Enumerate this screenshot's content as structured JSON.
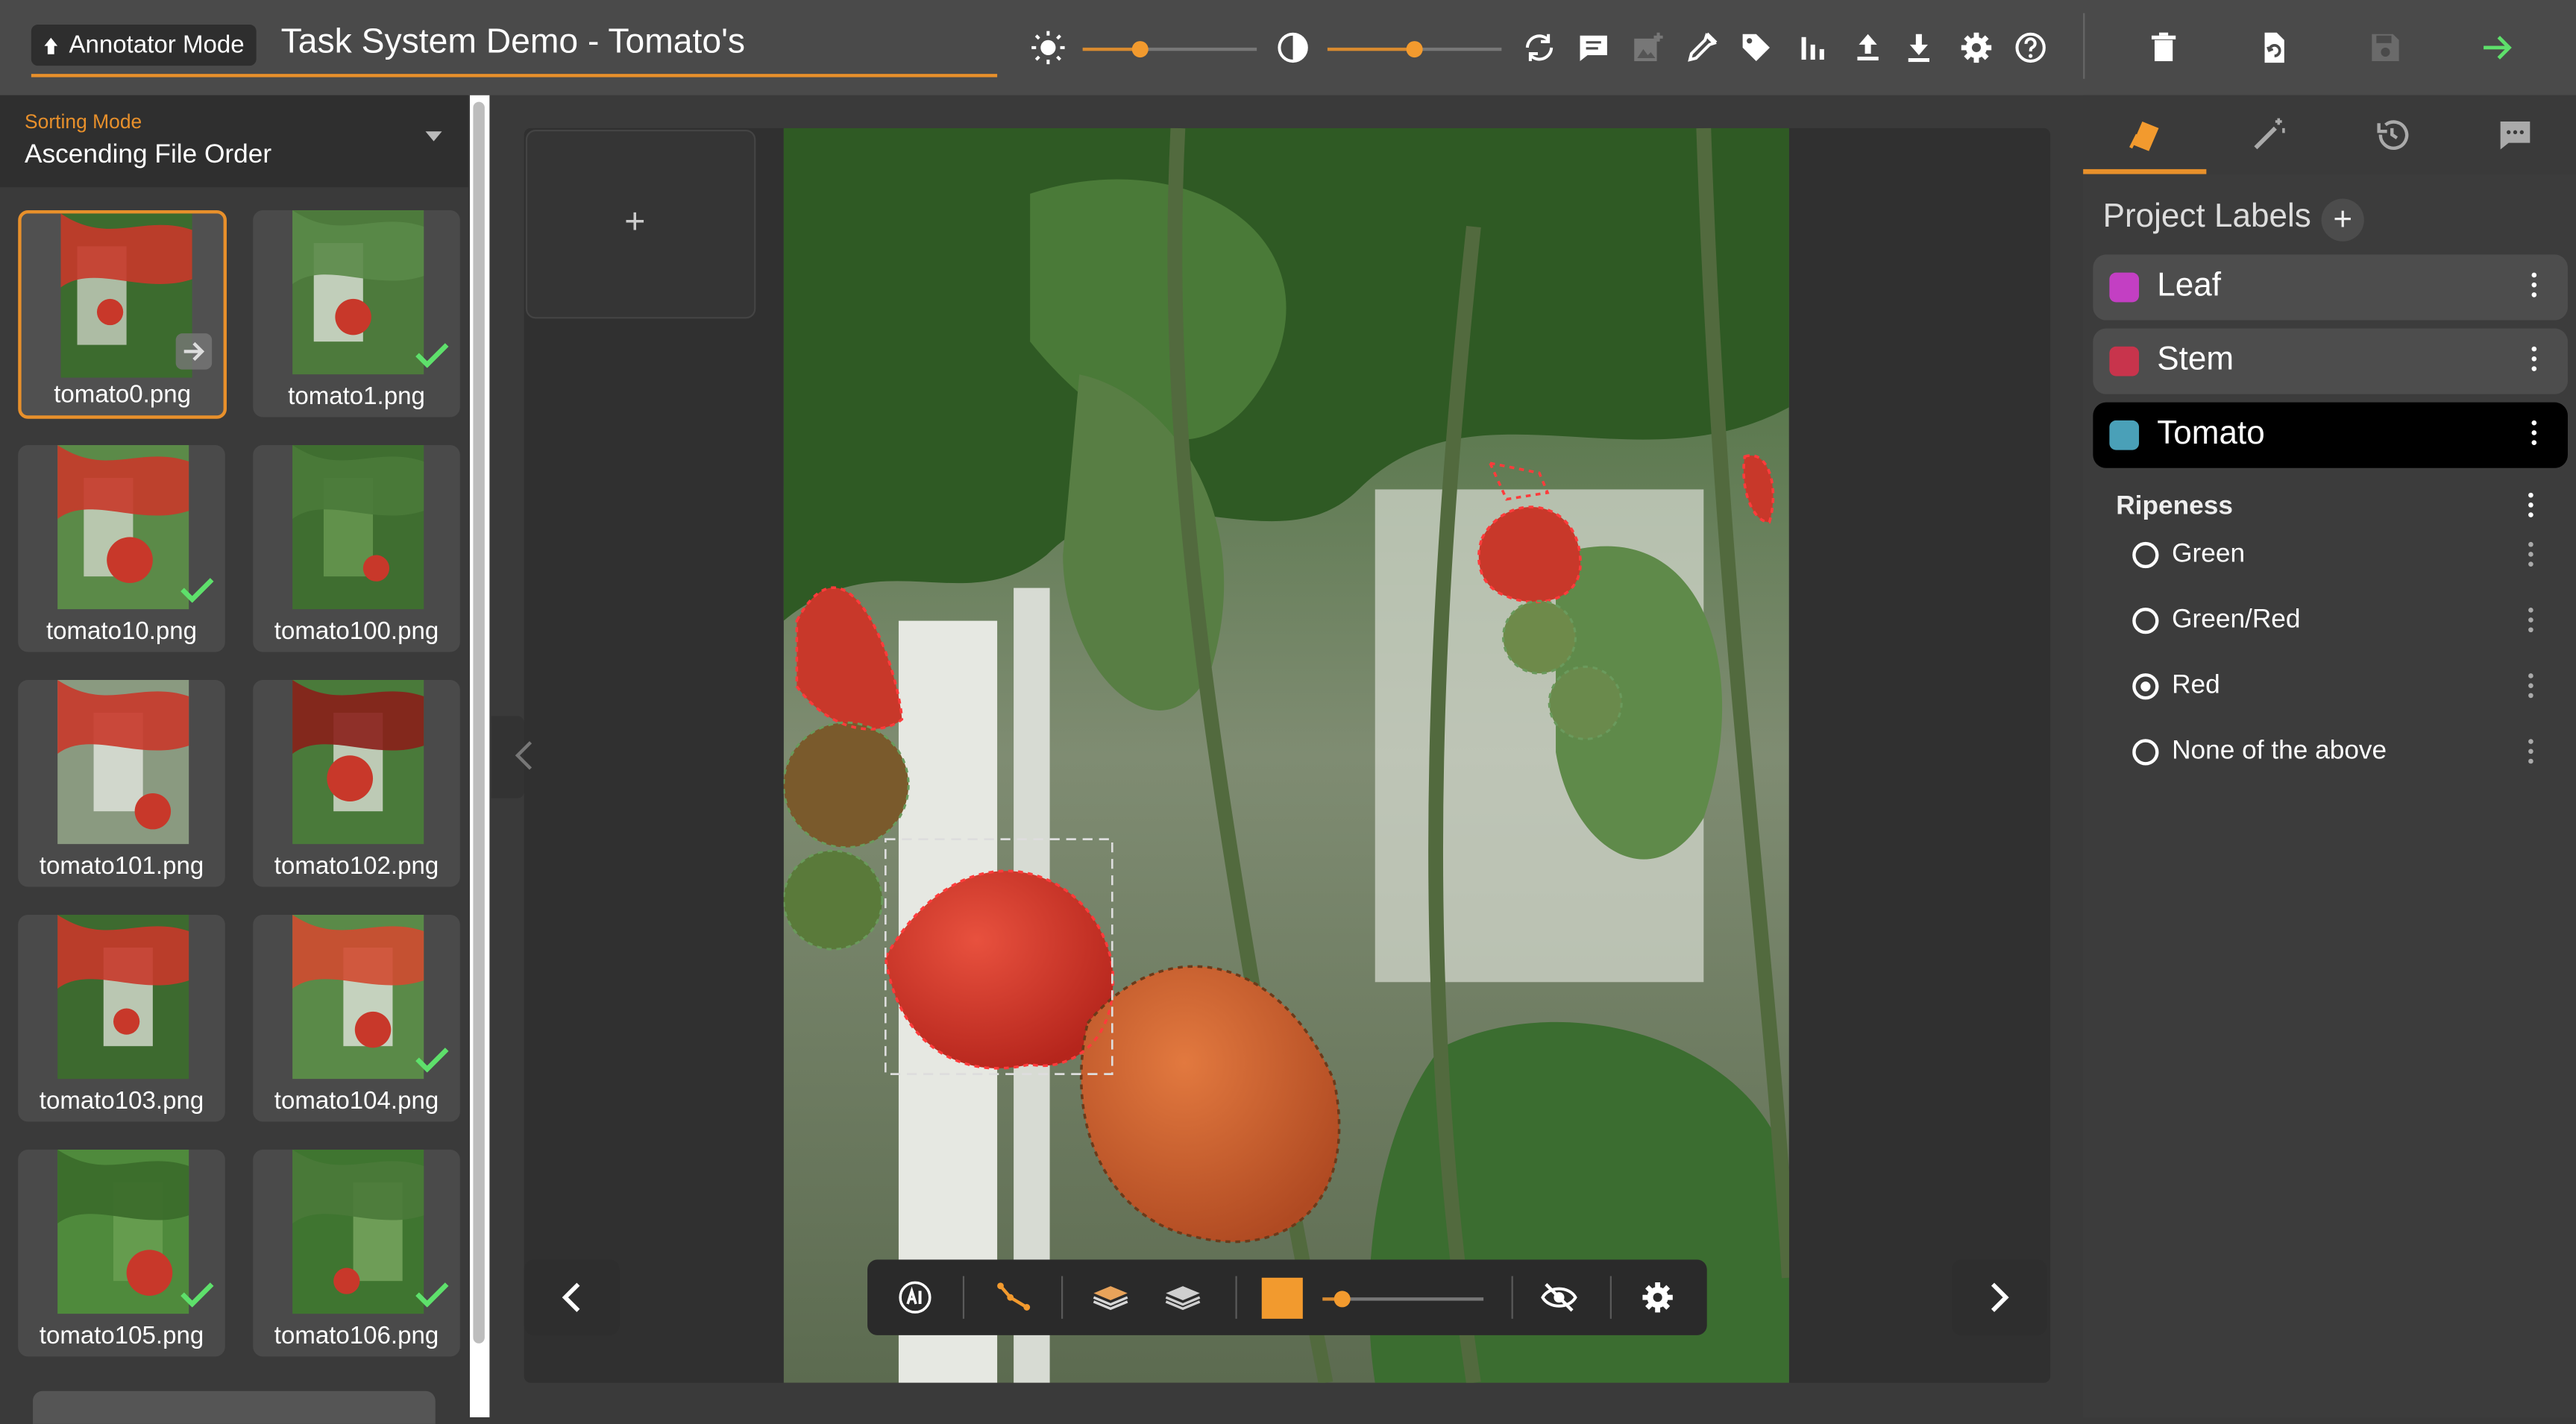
{
  "header": {
    "mode_label": "Annotator Mode",
    "task_title": "Task System Demo - Tomato's",
    "brightness_pct": 33,
    "contrast_pct": 50
  },
  "sorting": {
    "label": "Sorting Mode",
    "value": "Ascending File Order"
  },
  "files": [
    {
      "name": "tomato0.png",
      "selected": true,
      "done": false
    },
    {
      "name": "tomato1.png",
      "selected": false,
      "done": true
    },
    {
      "name": "tomato10.png",
      "selected": false,
      "done": true
    },
    {
      "name": "tomato100.png",
      "selected": false,
      "done": false
    },
    {
      "name": "tomato101.png",
      "selected": false,
      "done": false
    },
    {
      "name": "tomato102.png",
      "selected": false,
      "done": false
    },
    {
      "name": "tomato103.png",
      "selected": false,
      "done": false
    },
    {
      "name": "tomato104.png",
      "selected": false,
      "done": true
    },
    {
      "name": "tomato105.png",
      "selected": false,
      "done": true
    },
    {
      "name": "tomato106.png",
      "selected": false,
      "done": true
    }
  ],
  "workspace": {
    "add_symbol": "+",
    "opacity_pct": 12
  },
  "labels_panel": {
    "heading": "Project Labels",
    "add_symbol": "+",
    "labels": [
      {
        "name": "Leaf",
        "color": "#c33fc3",
        "active": false
      },
      {
        "name": "Stem",
        "color": "#c8344c",
        "active": false
      },
      {
        "name": "Tomato",
        "color": "#4aa0b8",
        "active": true
      }
    ],
    "attribute": {
      "heading": "Ripeness",
      "options": [
        "Green",
        "Green/Red",
        "Red",
        "None of the above"
      ],
      "selected": "Red"
    }
  },
  "colors": {
    "accent": "#e8902b",
    "confirm": "#5ee06b"
  }
}
